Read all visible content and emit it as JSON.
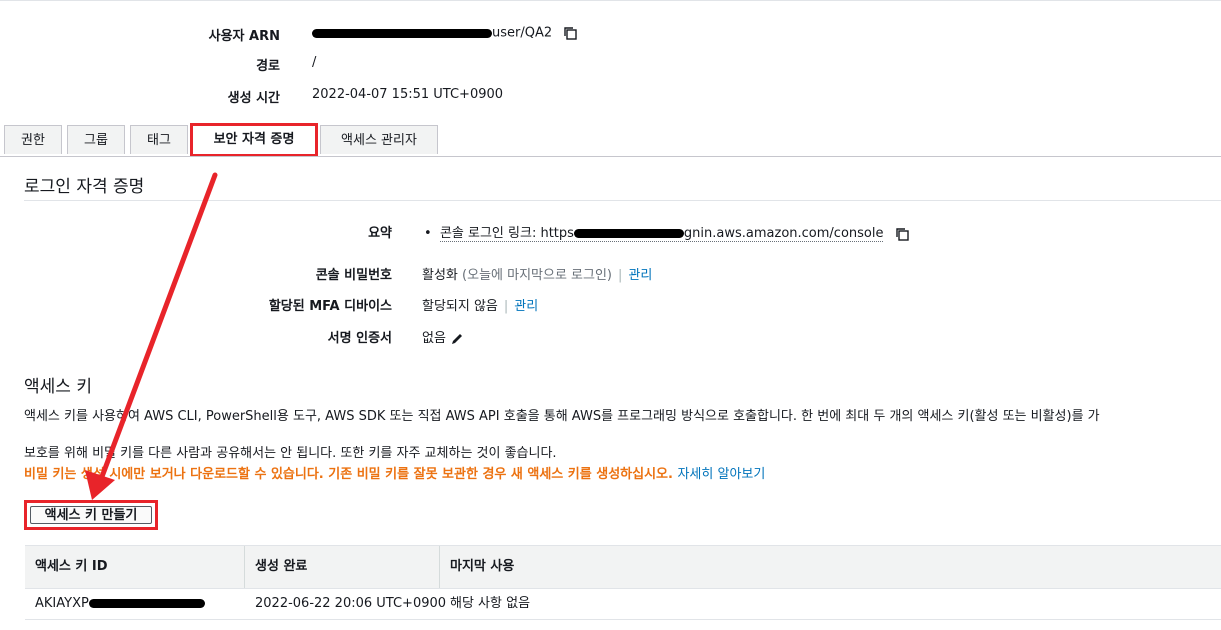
{
  "summary": {
    "arn_label": "사용자 ARN",
    "arn_suffix": "user/QA2",
    "path_label": "경로",
    "path_value": "/",
    "created_label": "생성 시간",
    "created_value": "2022-04-07 15:51 UTC+0900"
  },
  "tabs": [
    {
      "label": "권한"
    },
    {
      "label": "그룹"
    },
    {
      "label": "태그"
    },
    {
      "label": "보안 자격 증명",
      "active": true
    },
    {
      "label": "액세스 관리자"
    }
  ],
  "signin": {
    "title": "로그인 자격 증명",
    "summary_label": "요약",
    "console_link_prefix": "콘솔 로그인 링크: https",
    "console_link_suffix": "gnin.aws.amazon.com/console",
    "console_password_label": "콘솔 비밀번호",
    "console_password_value": "활성화",
    "console_password_note": "(오늘에 마지막으로 로그인)",
    "console_password_manage": "관리",
    "mfa_label": "할당된 MFA 디바이스",
    "mfa_value": "할당되지 않음",
    "mfa_manage": "관리",
    "signing_cert_label": "서명 인증서",
    "signing_cert_value": "없음"
  },
  "access_keys": {
    "title": "액세스 키",
    "description": "액세스 키를 사용하여 AWS CLI, PowerShell용 도구, AWS SDK 또는 직접 AWS API 호출을 통해 AWS를 프로그래밍 방식으로 호출합니다. 한 번에 최대 두 개의 액세스 키(활성 또는 비활성)를 가",
    "protect_note": "보호를 위해 비밀 키를 다른 사람과 공유해서는 안 됩니다. 또한 키를 자주 교체하는 것이 좋습니다.",
    "warning": "비밀 키는 생성 시에만 보거나 다운로드할 수 있습니다. 기존 비밀 키를 잘못 보관한 경우 새 액세스 키를 생성하십시오.",
    "learn_more": "자세히 알아보기",
    "create_button": "액세스 키 만들기",
    "table": {
      "headers": [
        "액세스 키 ID",
        "생성 완료",
        "마지막 사용"
      ],
      "rows": [
        {
          "id_prefix": "AKIAYXP",
          "created": "2022-06-22 20:06 UTC+0900",
          "last_used": "해당 사항 없음"
        }
      ]
    }
  },
  "colors": {
    "highlight": "#e8242a",
    "link": "#0073bb",
    "warning": "#ec7211"
  }
}
